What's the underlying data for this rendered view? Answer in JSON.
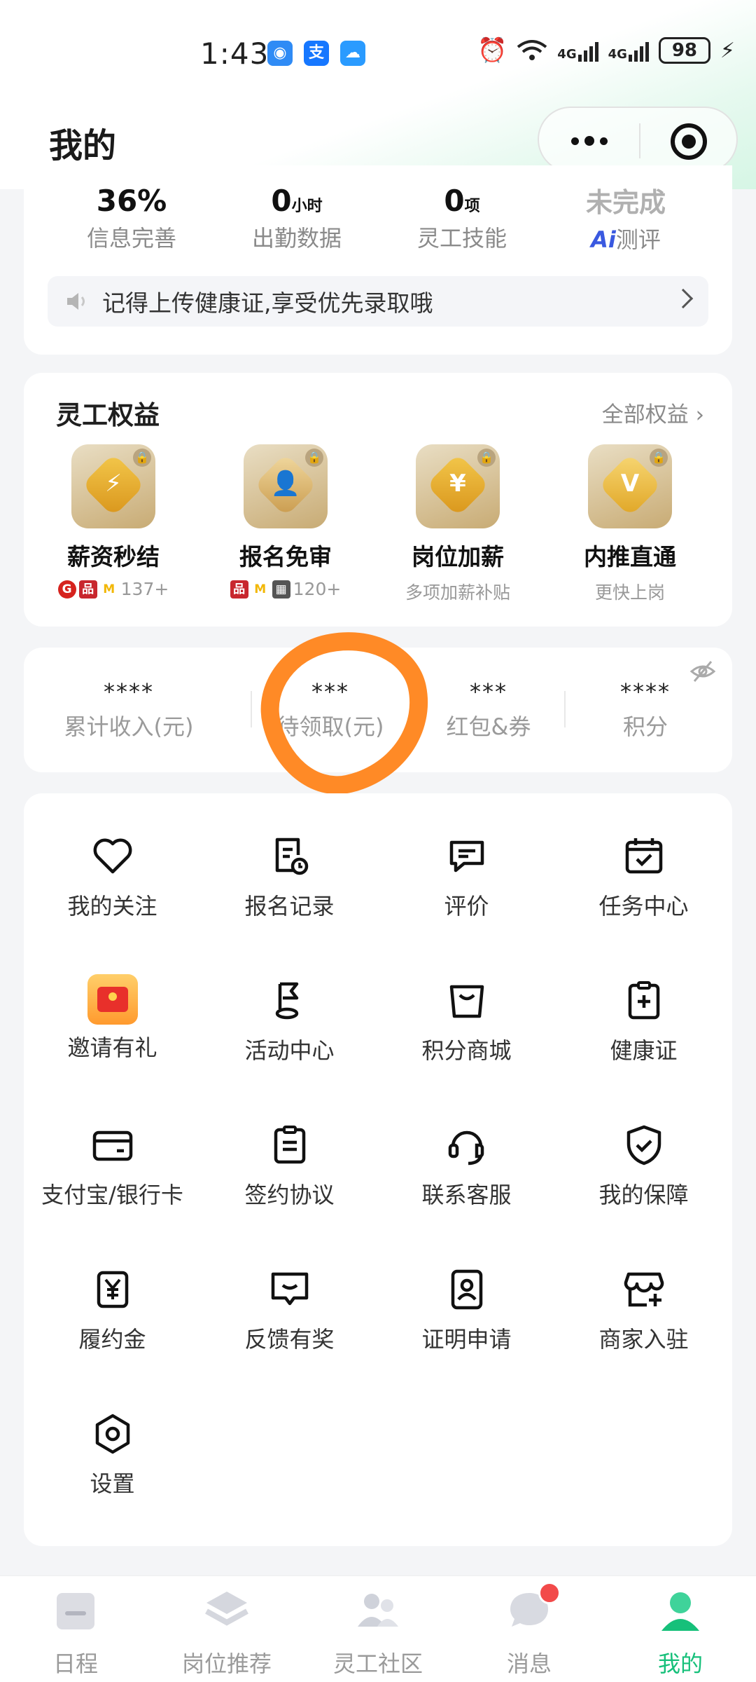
{
  "status_bar": {
    "time": "1:43",
    "battery": "98",
    "net1": "4G",
    "net2": "4G"
  },
  "header": {
    "title": "我的"
  },
  "profile": {
    "stats": [
      {
        "value": "36%",
        "unit": "",
        "label": "信息完善"
      },
      {
        "value": "0",
        "unit": "小时",
        "label": "出勤数据"
      },
      {
        "value": "0",
        "unit": "项",
        "label": "灵工技能"
      },
      {
        "value": "未完成",
        "unit": "",
        "label_prefix": "Ai",
        "label": "测评"
      }
    ],
    "notice": "记得上传健康证,享受优先录取哦"
  },
  "benefits": {
    "title": "灵工权益",
    "more": "全部权益",
    "items": [
      {
        "name": "薪资秒结",
        "sub": "137+",
        "symbol": "⚡"
      },
      {
        "name": "报名免审",
        "sub": "120+",
        "symbol": "👤"
      },
      {
        "name": "岗位加薪",
        "sub": "多项加薪补贴",
        "symbol": "¥"
      },
      {
        "name": "内推直通",
        "sub": "更快上岗",
        "symbol": "V"
      }
    ]
  },
  "wallet": [
    {
      "value": "****",
      "label": "累计收入(元)"
    },
    {
      "value": "***",
      "label": "待领取(元)"
    },
    {
      "value": "***",
      "label": "红包&券"
    },
    {
      "value": "****",
      "label": "积分"
    }
  ],
  "menu": [
    {
      "label": "我的关注",
      "icon": "heart-icon"
    },
    {
      "label": "报名记录",
      "icon": "record-clock-icon"
    },
    {
      "label": "评价",
      "icon": "comment-icon"
    },
    {
      "label": "任务中心",
      "icon": "calendar-check-icon"
    },
    {
      "label": "邀请有礼",
      "icon": "red-envelope-icon"
    },
    {
      "label": "活动中心",
      "icon": "flag-icon"
    },
    {
      "label": "积分商城",
      "icon": "shopping-bag-icon"
    },
    {
      "label": "健康证",
      "icon": "clipboard-plus-icon"
    },
    {
      "label": "支付宝/银行卡",
      "icon": "card-icon"
    },
    {
      "label": "签约协议",
      "icon": "document-icon"
    },
    {
      "label": "联系客服",
      "icon": "headset-icon"
    },
    {
      "label": "我的保障",
      "icon": "shield-check-icon"
    },
    {
      "label": "履约金",
      "icon": "yuan-box-icon"
    },
    {
      "label": "反馈有奖",
      "icon": "feedback-icon"
    },
    {
      "label": "证明申请",
      "icon": "id-badge-icon"
    },
    {
      "label": "商家入驻",
      "icon": "store-plus-icon"
    },
    {
      "label": "设置",
      "icon": "settings-icon"
    }
  ],
  "tabs": [
    {
      "label": "日程",
      "active": false
    },
    {
      "label": "岗位推荐",
      "active": false
    },
    {
      "label": "灵工社区",
      "active": false
    },
    {
      "label": "消息",
      "active": false
    },
    {
      "label": "我的",
      "active": true
    }
  ],
  "colors": {
    "accent": "#16c07a",
    "annotation": "#ff8a26",
    "badge": "#f24a4a"
  }
}
